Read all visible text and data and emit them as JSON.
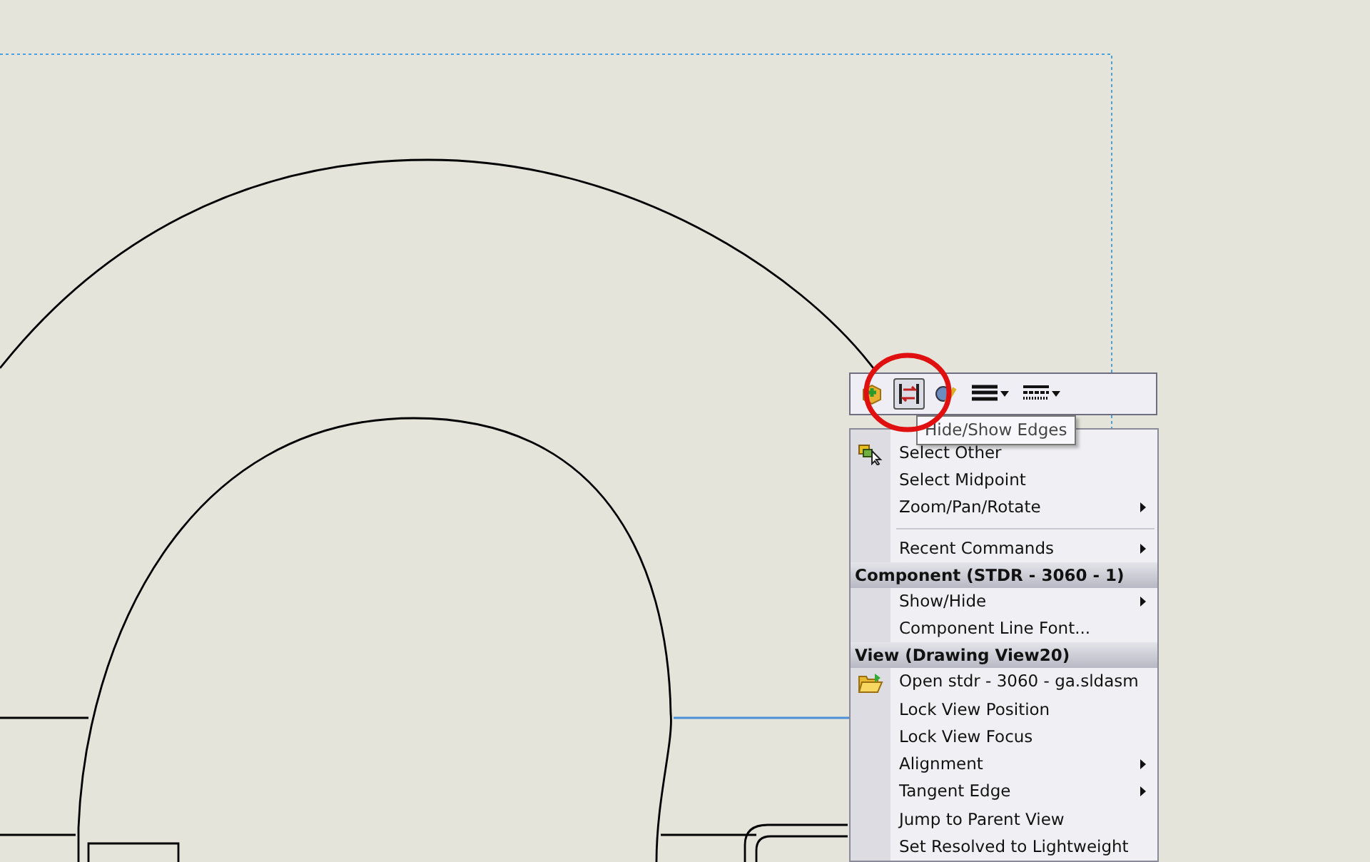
{
  "toolbar": {
    "buttons": [
      {
        "pressed": false,
        "dropdown": false
      },
      {
        "pressed": true,
        "dropdown": false
      },
      {
        "pressed": false,
        "dropdown": false
      },
      {
        "pressed": false,
        "dropdown": true
      },
      {
        "pressed": false,
        "dropdown": true
      }
    ]
  },
  "tooltip": "Hide/Show Edges",
  "menu": {
    "items": [
      {
        "kind": "item",
        "label": "Select Other",
        "submenu": false
      },
      {
        "kind": "item",
        "label": "Select Midpoint",
        "submenu": false
      },
      {
        "kind": "item",
        "label": "Zoom/Pan/Rotate",
        "submenu": true
      },
      {
        "kind": "separator"
      },
      {
        "kind": "item",
        "label": "Recent Commands",
        "submenu": true
      },
      {
        "kind": "header",
        "label": "Component (STDR - 3060 - 1)"
      },
      {
        "kind": "item",
        "label": "Show/Hide",
        "submenu": true
      },
      {
        "kind": "item",
        "label": "Component Line Font...",
        "submenu": false
      },
      {
        "kind": "header",
        "label": "View (Drawing View20)"
      },
      {
        "kind": "item",
        "label": "Open stdr - 3060 - ga.sldasm",
        "submenu": false
      },
      {
        "kind": "item",
        "label": "Lock View Position",
        "submenu": false
      },
      {
        "kind": "item",
        "label": "Lock View Focus",
        "submenu": false
      },
      {
        "kind": "item",
        "label": "Alignment",
        "submenu": true
      },
      {
        "kind": "item",
        "label": "Tangent Edge",
        "submenu": true
      },
      {
        "kind": "item",
        "label": "Jump to Parent View",
        "submenu": false
      },
      {
        "kind": "item",
        "label": "Set Resolved to Lightweight",
        "submenu": false
      }
    ]
  }
}
